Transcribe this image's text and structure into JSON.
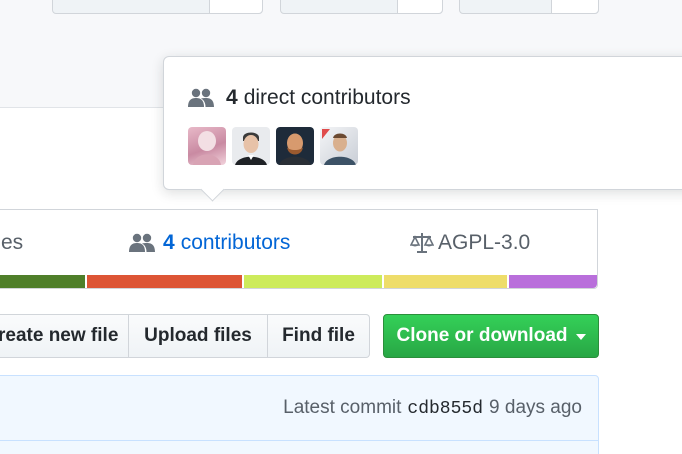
{
  "hovercard": {
    "count": "4",
    "label": "direct contributors",
    "avatars": [
      "contributor-1",
      "contributor-2",
      "contributor-3",
      "contributor-4"
    ]
  },
  "stats": {
    "partial_left": "es",
    "contributors_count": "4",
    "contributors_label": "contributors",
    "license": "AGPL-3.0"
  },
  "langbar": {
    "colors": [
      "#4f7f2a",
      "#dd5535",
      "#cdeb5b",
      "#eedd6a",
      "#b96fdb"
    ],
    "fractions": [
      0.16,
      0.265,
      0.235,
      0.21,
      0.15
    ]
  },
  "file_buttons": {
    "create": "reate new file",
    "upload": "Upload files",
    "find": "Find file"
  },
  "clone_button": {
    "label": "Clone or download"
  },
  "commit": {
    "prefix": "Latest commit",
    "sha": "cdb855d",
    "age": "9 days ago"
  },
  "colors": {
    "link": "#0366d6",
    "green": "#28a745",
    "commit_bg": "#f1f8ff"
  }
}
